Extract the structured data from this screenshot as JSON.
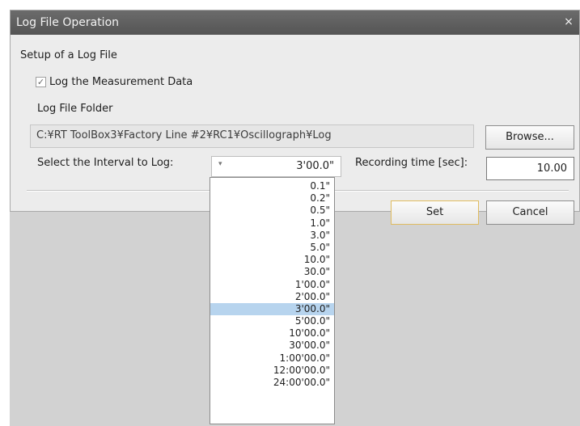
{
  "dialog": {
    "title": "Log File Operation",
    "close_glyph": "×",
    "setup_label": "Setup of a Log File",
    "log_checkbox": {
      "label": "Log the Measurement Data",
      "checked": true,
      "glyph": "✓"
    },
    "folder_label": "Log File Folder",
    "folder_path": "C:¥RT ToolBox3¥Factory Line #2¥RC1¥Oscillograph¥Log",
    "browse_label": "Browse...",
    "interval_label": "Select the Interval to Log:",
    "interval_arrow": "▾",
    "interval_value": "3'00.0\"",
    "recording_label": "Recording time [sec]:",
    "recording_value": "10.00",
    "set_label": "Set",
    "cancel_label": "Cancel"
  },
  "interval_options": [
    "0.1\"",
    "0.2\"",
    "0.5\"",
    "1.0\"",
    "3.0\"",
    "5.0\"",
    "10.0\"",
    "30.0\"",
    "1'00.0\"",
    "2'00.0\"",
    "3'00.0\"",
    "5'00.0\"",
    "10'00.0\"",
    "30'00.0\"",
    "1:00'00.0\"",
    "12:00'00.0\"",
    "24:00'00.0\""
  ],
  "selected_option_index": 10,
  "colors": {
    "titlebar": "#5f5f5f",
    "dialog_bg": "#ececec",
    "selection": "#b7d4ee",
    "default_button_border": "#e0bc60"
  }
}
